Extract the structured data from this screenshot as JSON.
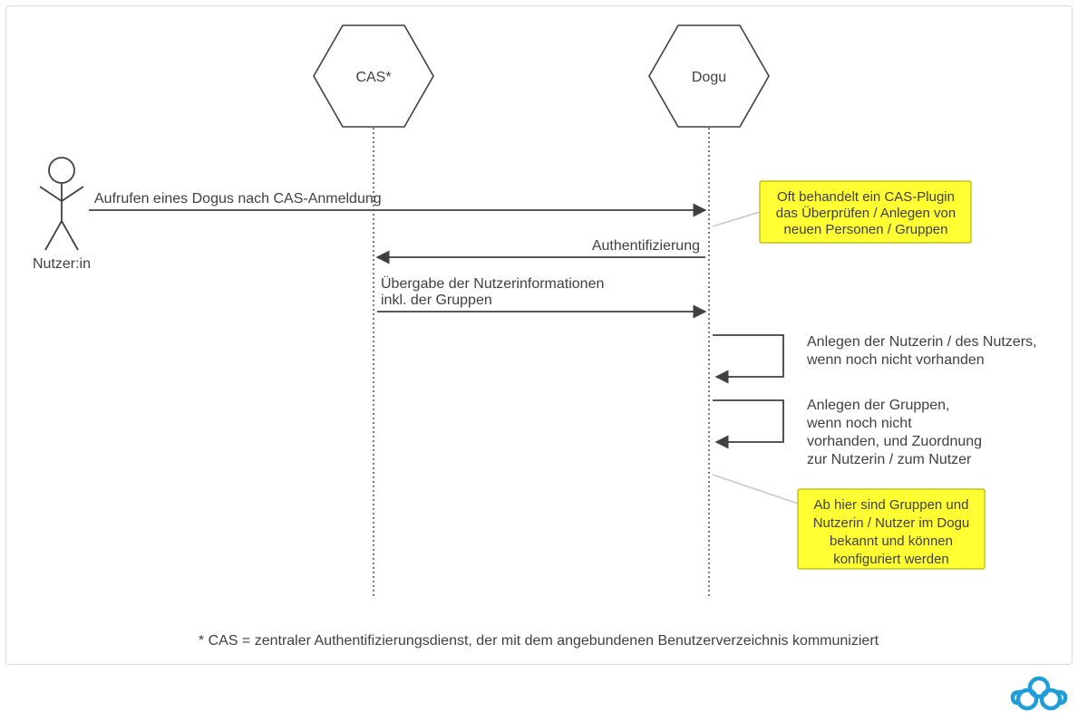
{
  "actors": {
    "user_label": "Nutzer:in",
    "cas_label": "CAS*",
    "dogu_label": "Dogu"
  },
  "messages": {
    "m1": "Aufrufen eines Dogus nach CAS-Anmeldung",
    "m2": "Authentifizierung",
    "m3_line1": "Übergabe der Nutzerinformationen",
    "m3_line2": "inkl. der Gruppen",
    "self1_line1": "Anlegen der Nutzerin / des Nutzers,",
    "self1_line2": "wenn noch nicht vorhanden",
    "self2_line1": "Anlegen der Gruppen,",
    "self2_line2": "wenn noch nicht",
    "self2_line3": "vorhanden, und Zuordnung",
    "self2_line4": "zur Nutzerin / zum Nutzer"
  },
  "notes": {
    "n1_l1": "Oft behandelt ein CAS-Plugin",
    "n1_l2": "das Überprüfen / Anlegen von",
    "n1_l3": "neuen Personen / Gruppen",
    "n2_l1": "Ab hier sind Gruppen und",
    "n2_l2": "Nutzerin / Nutzer im Dogu",
    "n2_l3": "bekannt und können",
    "n2_l4": "konfiguriert werden"
  },
  "footnote": "* CAS = zentraler Authentifizierungsdienst, der mit dem angebundenen Benutzerverzeichnis kommuniziert",
  "colors": {
    "stroke": "#404040",
    "note_fill": "#ffff33",
    "connector": "#c8c8c8",
    "logo": "#1e9dd8"
  }
}
